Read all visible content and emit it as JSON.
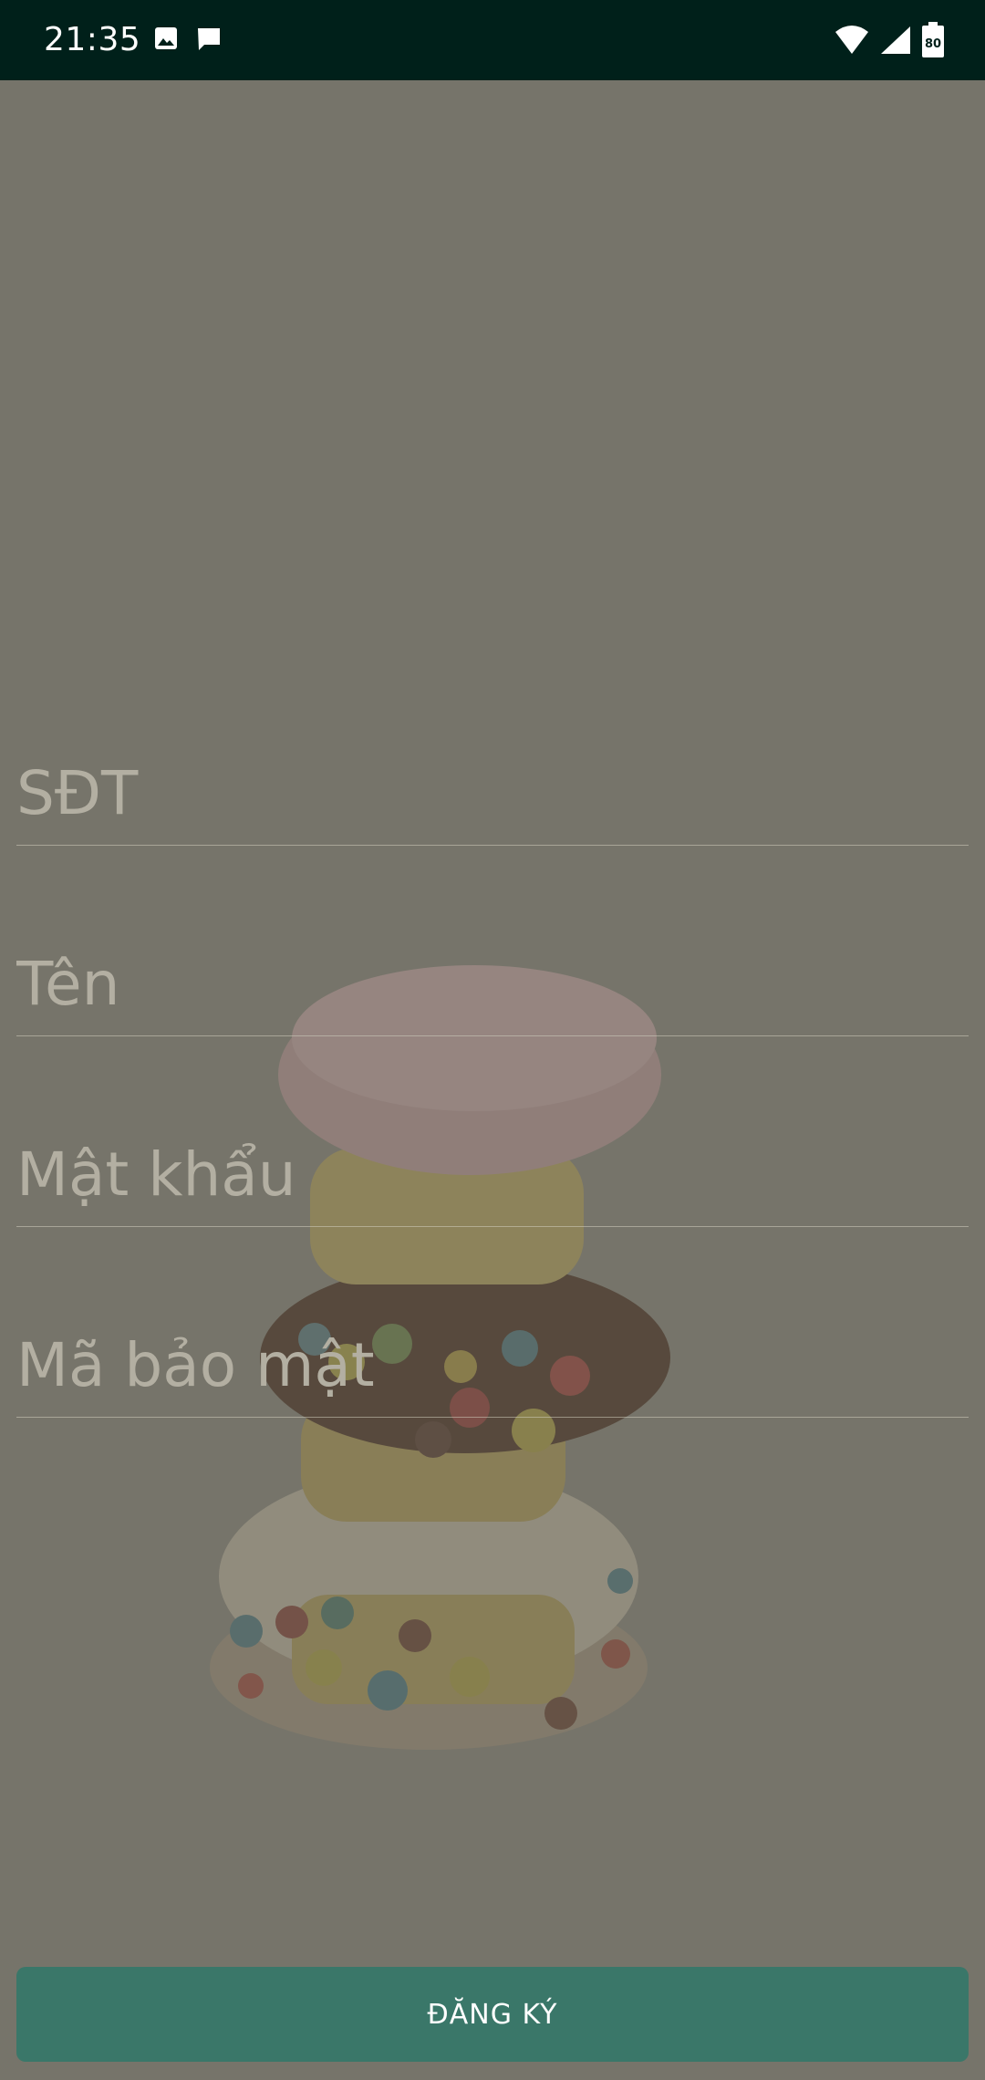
{
  "status_bar": {
    "time": "21:35",
    "left_icons": [
      "image-icon",
      "message-icon"
    ],
    "right_icons": [
      "wifi-icon",
      "signal-icon",
      "battery-icon"
    ],
    "battery_level": "80"
  },
  "form": {
    "phone_placeholder": "SĐT",
    "name_placeholder": "Tên",
    "password_placeholder": "Mật khẩu",
    "security_code_placeholder": "Mã bảo mật"
  },
  "register_button_label": "ĐĂNG KÝ",
  "colors": {
    "status_bar_bg": "#00201a",
    "button_bg": "#3a7769",
    "overlay": "#6c6a60"
  }
}
